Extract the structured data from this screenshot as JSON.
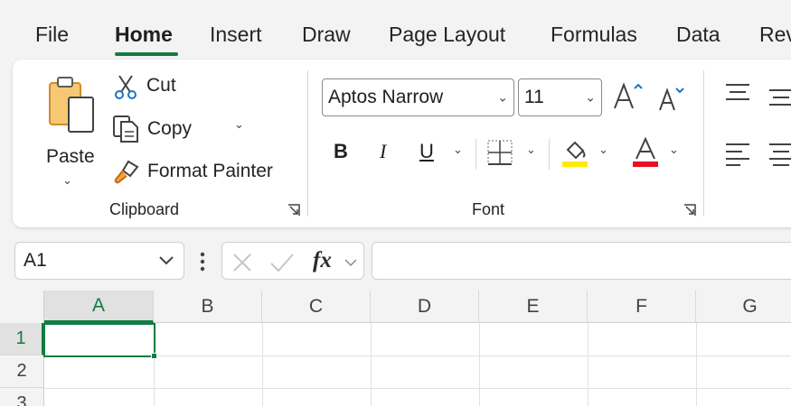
{
  "tabs": [
    {
      "label": "File",
      "active": false
    },
    {
      "label": "Home",
      "active": true
    },
    {
      "label": "Insert",
      "active": false
    },
    {
      "label": "Draw",
      "active": false
    },
    {
      "label": "Page Layout",
      "active": false
    },
    {
      "label": "Formulas",
      "active": false
    },
    {
      "label": "Data",
      "active": false
    },
    {
      "label": "Rev",
      "active": false
    }
  ],
  "clipboard": {
    "paste_label": "Paste",
    "cut_label": "Cut",
    "copy_label": "Copy",
    "format_painter_label": "Format Painter",
    "group_label": "Clipboard"
  },
  "font": {
    "font_name": "Aptos Narrow",
    "font_size": "11",
    "group_label": "Font",
    "bold_label": "B",
    "italic_label": "I",
    "underline_label": "U",
    "highlight_color": "#ffeb00",
    "font_color": "#e81123"
  },
  "formula_bar": {
    "name_box": "A1",
    "fx_label": "fx",
    "formula": ""
  },
  "grid": {
    "columns": [
      "A",
      "B",
      "C",
      "D",
      "E",
      "F",
      "G"
    ],
    "rows": [
      "1",
      "2",
      "3"
    ],
    "selected_column": "A",
    "selected_row": "1"
  },
  "accent_color": "#107c41"
}
